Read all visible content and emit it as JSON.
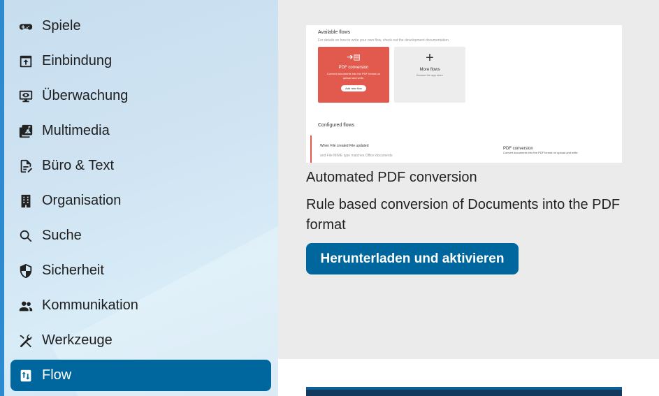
{
  "sidebar": {
    "items": [
      {
        "label": "Spiele",
        "icon": "gamepad-icon"
      },
      {
        "label": "Einbindung",
        "icon": "integration-icon"
      },
      {
        "label": "Überwachung",
        "icon": "monitor-eye-icon"
      },
      {
        "label": "Multimedia",
        "icon": "multimedia-icon"
      },
      {
        "label": "Büro & Text",
        "icon": "document-edit-icon"
      },
      {
        "label": "Organisation",
        "icon": "office-building-icon"
      },
      {
        "label": "Suche",
        "icon": "search-icon"
      },
      {
        "label": "Sicherheit",
        "icon": "shield-icon"
      },
      {
        "label": "Kommunikation",
        "icon": "people-icon"
      },
      {
        "label": "Werkzeuge",
        "icon": "tools-icon"
      },
      {
        "label": "Flow",
        "icon": "flow-icon",
        "active": true
      }
    ]
  },
  "app": {
    "preview": {
      "available_title": "Available flows",
      "available_sub": "For details on how to write your own flow, check out the development documentation.",
      "pdf_card_title": "PDF conversion",
      "pdf_card_desc": "Convert documents into the PDF format on upload and write.",
      "pdf_card_button": "Add new flow",
      "more_card_title": "More flows",
      "more_card_desc": "Browse the app store",
      "configured_title": "Configured flows",
      "rule_row1": "When  File created   File updated",
      "rule_row2": "and   File MIME type    matches    Office documents",
      "right_title": "PDF conversion",
      "right_desc": "Convert documents into the PDF format on upload and write."
    },
    "title": "Automated PDF conversion",
    "description": "Rule based conversion of Documents into the PDF format",
    "download_button": "Herunterladen und aktivieren"
  },
  "colors": {
    "accent": "#00679e",
    "sidebar_stripe": "#2b8ad0",
    "pdf_card": "#e25a4d"
  }
}
